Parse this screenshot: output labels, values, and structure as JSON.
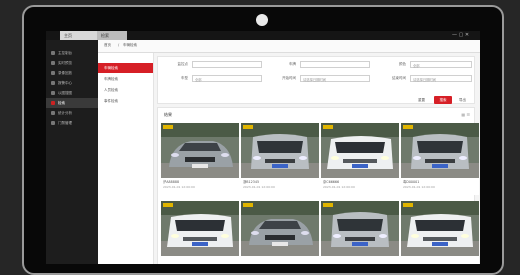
{
  "topbar": {
    "app_name": "Video Management Client",
    "tab_main": "主页",
    "tab_search": "检索",
    "window_controls": "— ▢ ✕"
  },
  "leftnav": {
    "items": [
      "主控制台",
      "实时预览",
      "录像回放",
      "报警中心",
      "以图搜图",
      "检索",
      "统计分析",
      "门禁管理"
    ],
    "active_index": 5
  },
  "breadcrumb": {
    "items": [
      "首页",
      "车辆检索"
    ]
  },
  "subnav": {
    "items": [
      "车辆检索",
      "车牌检索",
      "人员检索",
      "事件检索"
    ],
    "active_index": 0
  },
  "filter": {
    "row1": [
      {
        "label": "监控点",
        "value": ""
      },
      {
        "label": "车牌",
        "value": ""
      },
      {
        "label": "颜色",
        "value": "全部"
      }
    ],
    "row2": [
      {
        "label": "车型",
        "value": "全部"
      },
      {
        "label": "开始时间",
        "value": "请选择日期时间"
      },
      {
        "label": "结束时间",
        "value": "请选择日期时间"
      }
    ],
    "buttons": {
      "reset": "重置",
      "search": "搜索",
      "export": "导出"
    }
  },
  "results": {
    "title": "结果",
    "view_icons": "▦ ☰",
    "cards": [
      {
        "caption": "沪A88888",
        "time": "2023-01-01 12:00:00",
        "car": "sedan"
      },
      {
        "caption": "浙B12345",
        "time": "2023-01-01 12:00:00",
        "car": "mpv"
      },
      {
        "caption": "京C66666",
        "time": "2023-01-01 12:00:00",
        "car": "van"
      },
      {
        "caption": "粤D00001",
        "time": "2023-01-01 12:00:00",
        "car": "mpv"
      },
      {
        "caption": "",
        "time": "",
        "car": "van"
      },
      {
        "caption": "",
        "time": "",
        "car": "sedan"
      },
      {
        "caption": "",
        "time": "",
        "car": "mpv"
      },
      {
        "caption": "",
        "time": "",
        "car": "van"
      }
    ]
  },
  "colors": {
    "accent": "#d61f26",
    "nav_bg": "#1d1d1d",
    "bezel": "#080808"
  }
}
